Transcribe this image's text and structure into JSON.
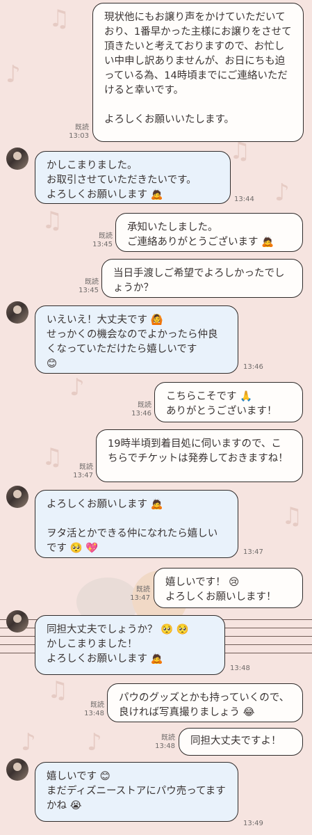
{
  "messages": [
    {
      "dir": "out",
      "text": "現状他にもお譲り声をかけていただいており、1番早かった主様にお譲りをさせて頂きたいと考えておりますので、お忙しい中申し訳ありませんが、お日にちも迫っている為、14時頃までにご連絡いただけると幸いです。\n\nよろしくお願いいたします。",
      "read": "既読",
      "time": "13:03"
    },
    {
      "dir": "in",
      "text": "かしこまりました。\nお取引させていただきたいです。\nよろしくお願いします 🙇",
      "time": "13:44"
    },
    {
      "dir": "out",
      "text": "承知いたしました。\nご連絡ありがとうございます 🙇",
      "read": "既読",
      "time": "13:45"
    },
    {
      "dir": "out",
      "text": "当日手渡しご希望でよろしかったでしょうか？",
      "read": "既読",
      "time": "13:45"
    },
    {
      "dir": "in",
      "text": "いえいえ！大丈夫です 🙆\nせっかくの機会なのでよかったら仲良くなっていただけたら嬉しいです\n😊",
      "time": "13:46"
    },
    {
      "dir": "out",
      "text": "こちらこそです 🙏\nありがとうございます！",
      "read": "既読",
      "time": "13:46"
    },
    {
      "dir": "out",
      "text": "19時半頃到着目処に伺いますので、こちらでチケットは発券しておきますね！",
      "read": "既読",
      "time": "13:47"
    },
    {
      "dir": "in",
      "text": "よろしくお願いします 🙇\n\nヲタ活とかできる仲になれたら嬉しいです 🥺 💖",
      "time": "13:47"
    },
    {
      "dir": "out",
      "text": "嬉しいです！ 😢\nよろしくお願いします！",
      "read": "既読",
      "time": "13:47"
    },
    {
      "dir": "in",
      "text": "同担大丈夫でしょうか？ 🥺 🥺\nかしこまりました！\nよろしくお願いします 🙇",
      "time": "13:48"
    },
    {
      "dir": "out",
      "text": "パウのグッズとかも持っていくので、良ければ写真撮りましょう 😂",
      "read": "既読",
      "time": "13:48"
    },
    {
      "dir": "out",
      "text": "同担大丈夫ですよ！",
      "read": "既読",
      "time": "13:48"
    },
    {
      "dir": "in",
      "text": "嬉しいです 😊\nまだディズニーストアにパウ売ってますかね 😭",
      "time": "13:49"
    }
  ],
  "colors": {
    "background": "#f6e4e0",
    "incoming_bubble": "#e9f2fb",
    "outgoing_bubble": "#fffdfb"
  }
}
